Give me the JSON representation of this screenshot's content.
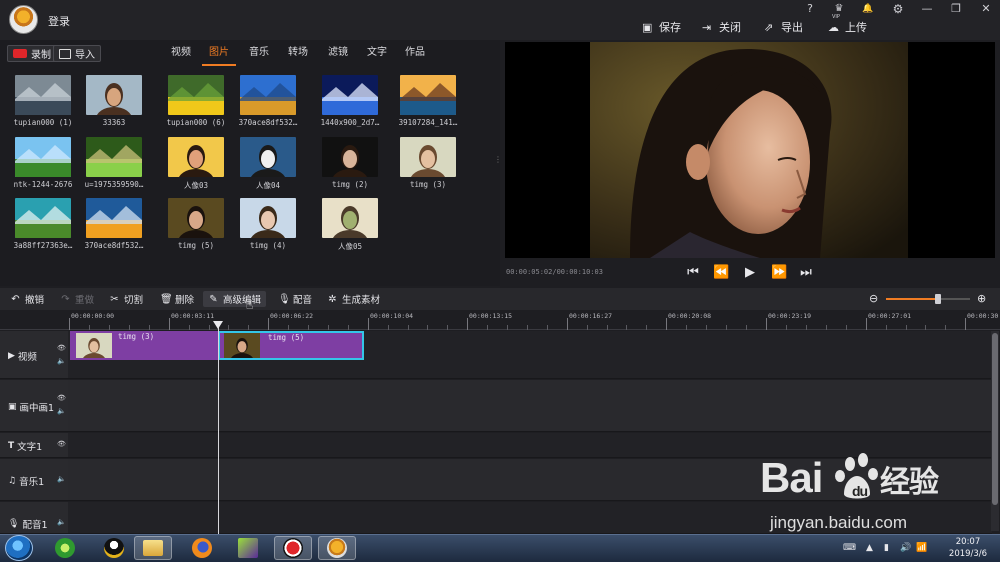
{
  "app": {
    "login_label": "登录",
    "window_controls": [
      {
        "name": "help",
        "glyph": "?"
      },
      {
        "name": "vip",
        "glyph": "♛",
        "sub": "VIP"
      },
      {
        "name": "notifications",
        "glyph": "🔔"
      },
      {
        "name": "settings",
        "glyph": "⚙"
      },
      {
        "name": "minimize",
        "glyph": "—"
      },
      {
        "name": "restore",
        "glyph": "❐"
      },
      {
        "name": "close",
        "glyph": "✕"
      }
    ],
    "actions": {
      "save": "保存",
      "close": "关闭",
      "export": "导出",
      "upload": "上传"
    }
  },
  "library": {
    "record_label": "录制",
    "import_label": "导入",
    "tabs": [
      "视频",
      "图片",
      "音乐",
      "转场",
      "滤镜",
      "文字",
      "作品"
    ],
    "active_tab": "图片",
    "items": [
      {
        "caption": "tupian000 (1)",
        "art": "bag"
      },
      {
        "caption": "33363",
        "art": "girl-hat"
      },
      {
        "caption": "tupian000 (6)",
        "art": "flower"
      },
      {
        "caption": "370ace8df532…",
        "art": "lake"
      },
      {
        "caption": "1440x900_2d7…",
        "art": "night"
      },
      {
        "caption": "39107284_141…",
        "art": "sunset"
      },
      {
        "caption": "ntk-1244-2676",
        "art": "hills"
      },
      {
        "caption": "u=1975359590…",
        "art": "avenue"
      },
      {
        "caption": "人像03",
        "art": "girl-flower"
      },
      {
        "caption": "人像04",
        "art": "girl-bench"
      },
      {
        "caption": "timg (2)",
        "art": "girl-dark"
      },
      {
        "caption": "timg (3)",
        "art": "girl-hat2"
      },
      {
        "caption": "3a88ff27363e…",
        "art": "river"
      },
      {
        "caption": "370ace8df532…",
        "art": "lake2"
      },
      {
        "caption": "timg (5)",
        "art": "girl-profile"
      },
      {
        "caption": "timg (4)",
        "art": "girl-field"
      },
      {
        "caption": "人像05",
        "art": "girl-tree"
      }
    ]
  },
  "preview": {
    "timecode": "00:00:05:02/00:00:10:03",
    "controls": [
      "⏮",
      "⏪",
      "▶",
      "⏩",
      "⏭"
    ]
  },
  "toolbar": {
    "undo": "撤销",
    "redo": "重做",
    "cut": "切割",
    "delete": "删除",
    "advanced_edit": "高级编辑",
    "dub": "配音",
    "generate": "生成素材",
    "zoom_level": 0.6
  },
  "timeline": {
    "ruler": [
      "00:00:00:00",
      "00:00:03:11",
      "00:00:06:22",
      "00:00:10:04",
      "00:00:13:15",
      "00:00:16:27",
      "00:00:20:08",
      "00:00:23:19",
      "00:00:27:01",
      "00:00:30"
    ],
    "tracks": [
      "视频",
      "画中画1",
      "文字1",
      "音乐1",
      "配音1"
    ],
    "clips": [
      {
        "name": "timg (3)",
        "selected": false
      },
      {
        "name": "timg (5)",
        "selected": true
      }
    ]
  },
  "taskbar": {
    "time": "20:07",
    "date": "2019/3/6"
  },
  "watermark": {
    "brand": "Baidu经验",
    "url": "jingyan.baidu.com"
  },
  "colors": {
    "accent": "#f07c23",
    "clip": "#7e3ea3",
    "clip_selected_border": "#34c6e8",
    "record": "#e0262a"
  }
}
